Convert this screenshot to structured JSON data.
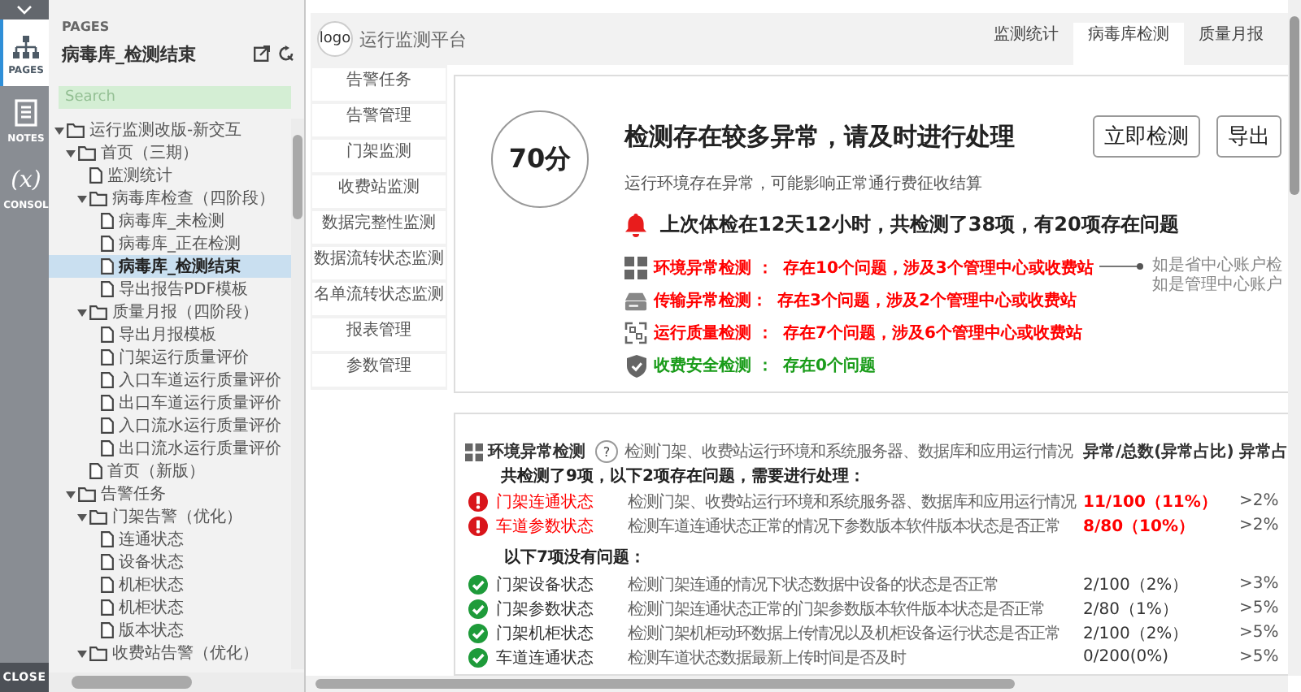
{
  "rail": {
    "tabs": [
      {
        "kind": "pages",
        "label": "PAGES",
        "selected": true
      },
      {
        "kind": "notes",
        "label": "NOTES",
        "selected": false
      },
      {
        "kind": "console",
        "label": "CONSOL",
        "glyph": "(x)",
        "selected": false
      }
    ],
    "close": "CLOSE"
  },
  "pages": {
    "heading": "PAGES",
    "title": "病毒库_检测结束",
    "search": {
      "placeholder": "Search"
    },
    "tree": [
      {
        "label": "运行监测改版-新交互",
        "kind": "folder",
        "expanded": true,
        "selected": false,
        "children": [
          {
            "label": "首页（三期）",
            "kind": "folder",
            "expanded": true,
            "selected": false,
            "children": [
              {
                "label": "监测统计",
                "kind": "page",
                "selected": false
              },
              {
                "label": "病毒库检查（四阶段）",
                "kind": "folder",
                "expanded": true,
                "selected": false,
                "children": [
                  {
                    "label": "病毒库_未检测",
                    "kind": "page",
                    "selected": false
                  },
                  {
                    "label": "病毒库_正在检测",
                    "kind": "page",
                    "selected": false
                  },
                  {
                    "label": "病毒库_检测结束",
                    "kind": "page",
                    "selected": true
                  },
                  {
                    "label": "导出报告PDF模板",
                    "kind": "page",
                    "selected": false
                  }
                ]
              },
              {
                "label": "质量月报（四阶段）",
                "kind": "folder",
                "expanded": true,
                "selected": false,
                "children": [
                  {
                    "label": "导出月报模板",
                    "kind": "page",
                    "selected": false
                  },
                  {
                    "label": "门架运行质量评价",
                    "kind": "page",
                    "selected": false
                  },
                  {
                    "label": "入口车道运行质量评价",
                    "kind": "page",
                    "selected": false
                  },
                  {
                    "label": "出口车道运行质量评价",
                    "kind": "page",
                    "selected": false
                  },
                  {
                    "label": "入口流水运行质量评价",
                    "kind": "page",
                    "selected": false
                  },
                  {
                    "label": "出口流水运行质量评价",
                    "kind": "page",
                    "selected": false
                  }
                ]
              },
              {
                "label": "首页（新版）",
                "kind": "page",
                "selected": false
              }
            ]
          },
          {
            "label": "告警任务",
            "kind": "folder",
            "expanded": true,
            "selected": false,
            "children": [
              {
                "label": "门架告警（优化）",
                "kind": "folder",
                "expanded": true,
                "selected": false,
                "children": [
                  {
                    "label": "连通状态",
                    "kind": "page",
                    "selected": false
                  },
                  {
                    "label": "设备状态",
                    "kind": "page",
                    "selected": false
                  },
                  {
                    "label": "机柜状态",
                    "kind": "page",
                    "selected": false
                  },
                  {
                    "label": "机柜状态",
                    "kind": "page",
                    "selected": false
                  },
                  {
                    "label": "版本状态",
                    "kind": "page",
                    "selected": false
                  }
                ]
              },
              {
                "label": "收费站告警（优化）",
                "kind": "folder",
                "expanded": true,
                "selected": false
              }
            ]
          }
        ]
      }
    ]
  },
  "app": {
    "logo": "logo",
    "title": "运行监测平台",
    "tabs": [
      {
        "label": "监测统计",
        "selected": false
      },
      {
        "label": "病毒库检测",
        "selected": true
      },
      {
        "label": "质量月报",
        "selected": false
      }
    ],
    "menu": [
      {
        "label": "告警任务",
        "selected": false
      },
      {
        "label": "告警管理",
        "selected": false
      },
      {
        "label": "门架监测",
        "selected": false
      },
      {
        "label": "收费站监测",
        "selected": false
      },
      {
        "label": "数据完整性监测",
        "selected": false
      },
      {
        "label": "数据流转状态监测",
        "selected": false
      },
      {
        "label": "名单流转状态监测",
        "selected": false
      },
      {
        "label": "报表管理",
        "selected": false
      },
      {
        "label": "参数管理",
        "selected": false
      }
    ],
    "summary": {
      "score": "70分",
      "heading": "检测存在较多异常，请及时进行处理",
      "buttons": [
        "立即检测",
        "导出"
      ],
      "subtitle": "运行环境存在异常，可能影响正常通行费征收结算",
      "alert": "上次体检在12天12小时，共检测了38项，有20项存在问题",
      "checks": [
        {
          "kind": "environment",
          "problem": true,
          "label": "环境异常检测 ：",
          "result": "存在10个问题，涉及3个管理中心或收费站",
          "note": [
            "如是省中心账户检",
            "如是管理中心账户"
          ]
        },
        {
          "kind": "transmission",
          "problem": true,
          "label": "传输异常检测：",
          "result": "存在3个问题，涉及2个管理中心或收费站"
        },
        {
          "kind": "quality",
          "problem": true,
          "label": "运行质量检测 ：",
          "result": "存在7个问题，涉及6个管理中心或收费站"
        },
        {
          "kind": "security",
          "problem": false,
          "label": "收费安全检测 ：",
          "result": "存在0个问题"
        }
      ]
    },
    "detail": {
      "title": "环境异常检测",
      "help": "?",
      "description": "检测门架、收费站运行环境和系统服务器、数据库和应用运行情况",
      "columns": [
        "异常/总数(异常占比)",
        "异常占"
      ],
      "problem_summary": "共检测了9项，以下2项存在问题，需要进行处理：",
      "problems": [
        {
          "problem": true,
          "name": "门架连通状态",
          "description": "检测门架、收费站运行环境和系统服务器、数据库和应用运行情况",
          "ratio": "11/100（11%）",
          "threshold": ">2%"
        },
        {
          "problem": true,
          "name": "车道参数状态",
          "description": "检测车道连通状态正常的情况下参数版本软件版本状态是否正常",
          "ratio": "8/80（10%）",
          "threshold": ">2%"
        }
      ],
      "ok_summary": "以下7项没有问题：",
      "passed": [
        {
          "problem": false,
          "name": "门架设备状态",
          "description": "检测门架连通的情况下状态数据中设备的状态是否正常",
          "ratio": "2/100（2%）",
          "threshold": ">3%"
        },
        {
          "problem": false,
          "name": "门架参数状态",
          "description": "检测门架连通状态正常的门架参数版本软件版本状态是否正常",
          "ratio": "2/80（1%）",
          "threshold": ">5%"
        },
        {
          "problem": false,
          "name": "门架机柜状态",
          "description": "检测门架机柜动环数据上传情况以及机柜设备运行状态是否正常",
          "ratio": "2/100（2%）",
          "threshold": ">5%"
        },
        {
          "problem": false,
          "name": "车道连通状态",
          "description": "检测车道状态数据最新上传时间是否及时",
          "ratio": "0/200(0%)",
          "threshold": ">5%"
        }
      ]
    }
  }
}
